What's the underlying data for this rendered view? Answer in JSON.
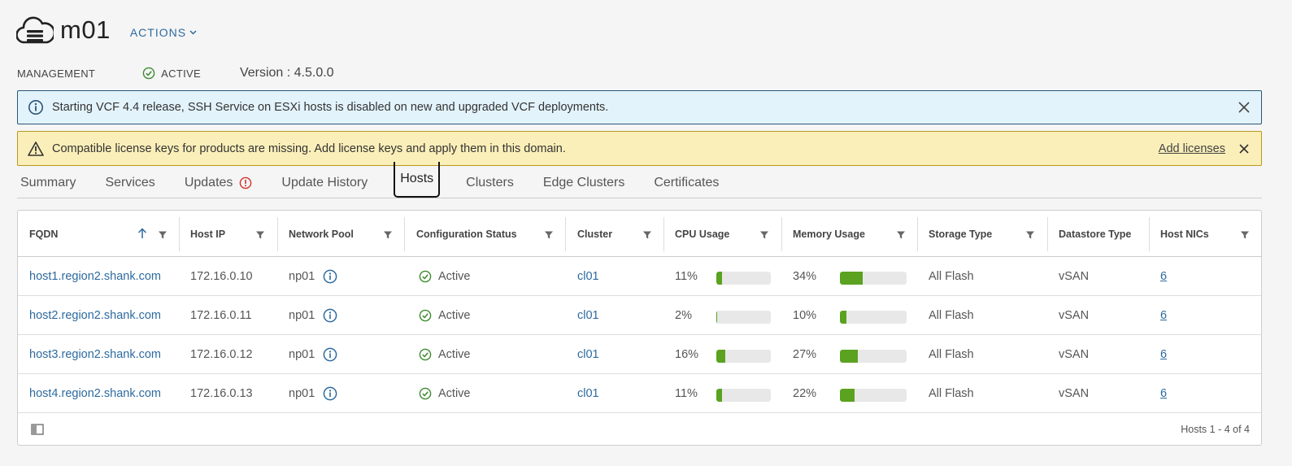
{
  "header": {
    "title": "m01",
    "actions_label": "ACTIONS",
    "icon": "cloud-server-icon"
  },
  "meta": {
    "type": "MANAGEMENT",
    "status": "ACTIVE",
    "version": "Version : 4.5.0.0"
  },
  "alerts": {
    "info": {
      "text": "Starting VCF 4.4 release, SSH Service on ESXi hosts is disabled on new and upgraded VCF deployments."
    },
    "warning": {
      "text": "Compatible license keys for products are missing. Add license keys and apply them in this domain.",
      "link": "Add licenses"
    }
  },
  "tabs": [
    {
      "label": "Summary",
      "active": false
    },
    {
      "label": "Services",
      "active": false
    },
    {
      "label": "Updates",
      "active": false,
      "alert": true
    },
    {
      "label": "Update History",
      "active": false
    },
    {
      "label": "Hosts",
      "active": true
    },
    {
      "label": "Clusters",
      "active": false
    },
    {
      "label": "Edge Clusters",
      "active": false
    },
    {
      "label": "Certificates",
      "active": false
    }
  ],
  "grid": {
    "columns": [
      "FQDN",
      "Host IP",
      "Network Pool",
      "Configuration Status",
      "Cluster",
      "CPU Usage",
      "Memory Usage",
      "Storage Type",
      "Datastore Type",
      "Host NICs"
    ],
    "rows": [
      {
        "fqdn": "host1.region2.shank.com",
        "ip": "172.16.0.10",
        "pool": "np01",
        "status": "Active",
        "cluster": "cl01",
        "cpu": "11%",
        "cpu_pct": 11,
        "mem": "34%",
        "mem_pct": 34,
        "storage": "All Flash",
        "datastore": "vSAN",
        "nics": "6"
      },
      {
        "fqdn": "host2.region2.shank.com",
        "ip": "172.16.0.11",
        "pool": "np01",
        "status": "Active",
        "cluster": "cl01",
        "cpu": "2%",
        "cpu_pct": 2,
        "mem": "10%",
        "mem_pct": 10,
        "storage": "All Flash",
        "datastore": "vSAN",
        "nics": "6"
      },
      {
        "fqdn": "host3.region2.shank.com",
        "ip": "172.16.0.12",
        "pool": "np01",
        "status": "Active",
        "cluster": "cl01",
        "cpu": "16%",
        "cpu_pct": 16,
        "mem": "27%",
        "mem_pct": 27,
        "storage": "All Flash",
        "datastore": "vSAN",
        "nics": "6"
      },
      {
        "fqdn": "host4.region2.shank.com",
        "ip": "172.16.0.13",
        "pool": "np01",
        "status": "Active",
        "cluster": "cl01",
        "cpu": "11%",
        "cpu_pct": 11,
        "mem": "22%",
        "mem_pct": 22,
        "storage": "All Flash",
        "datastore": "vSAN",
        "nics": "6"
      }
    ],
    "footer": "Hosts 1 - 4 of 4"
  },
  "colors": {
    "accent": "#2d6a9f",
    "success": "#3c8a2e",
    "bar_fill": "#5aa220",
    "info_bg": "#e3f3fb",
    "warn_bg": "#fbefb9",
    "danger": "#d0312d"
  }
}
